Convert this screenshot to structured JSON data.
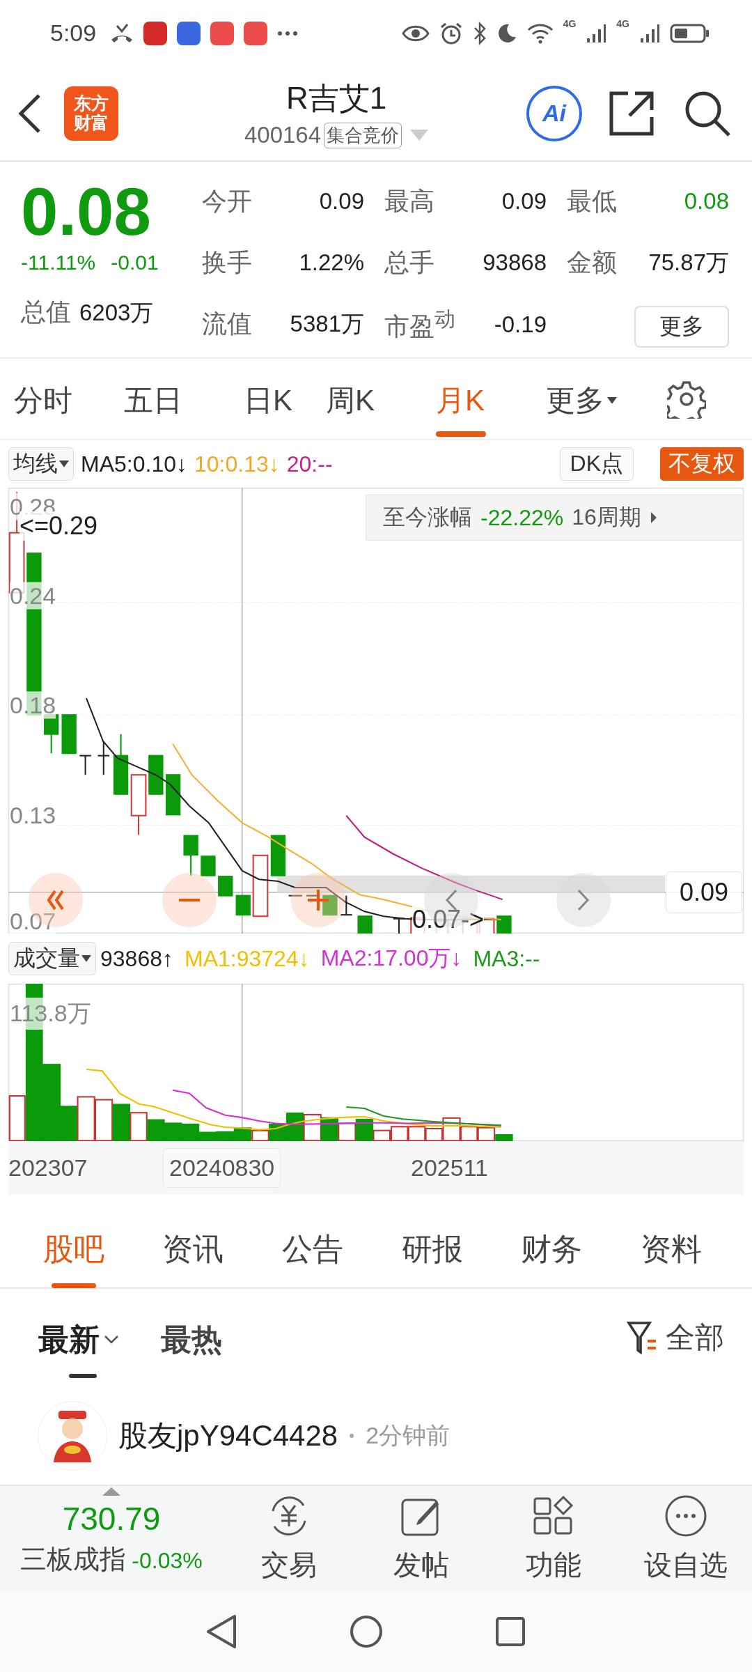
{
  "status_bar": {
    "time": "5:09",
    "signals": [
      {
        "label": "4G"
      },
      {
        "label": "4G"
      }
    ]
  },
  "header": {
    "logo_lines": [
      "东方",
      "财富"
    ],
    "title": "R吉艾1",
    "code": "400164",
    "badge": "集合竞价",
    "ai_label": "Ai"
  },
  "quote": {
    "price": "0.08",
    "change_pct": "-11.11%",
    "change": "-0.01",
    "total_value": {
      "label": "总值",
      "value": "6203万"
    },
    "stats": [
      {
        "label": "今开",
        "value": "0.09",
        "down": false
      },
      {
        "label": "最高",
        "value": "0.09",
        "down": false
      },
      {
        "label": "最低",
        "value": "0.08",
        "down": true
      },
      {
        "label": "换手",
        "value": "1.22%",
        "down": false
      },
      {
        "label": "总手",
        "value": "93868",
        "down": false
      },
      {
        "label": "金额",
        "value": "75.87万",
        "down": false
      },
      {
        "label": "流值",
        "value": "5381万",
        "down": false
      },
      {
        "label": "市盈$^{动}$",
        "value": "-0.19",
        "down": false
      }
    ],
    "more_button": "更多"
  },
  "period_tabs": [
    {
      "label": "分时",
      "selected": false
    },
    {
      "label": "五日",
      "selected": false
    },
    {
      "label": "日K",
      "selected": false
    },
    {
      "label": "周K",
      "selected": false
    },
    {
      "label": "月K",
      "selected": true
    },
    {
      "label": "更多",
      "selected": false,
      "dropdown": true
    }
  ],
  "kline": {
    "indicator": "均线",
    "mas": [
      {
        "text": "MA5:0.10↓",
        "color": "#222222"
      },
      {
        "text": "10:0.13↓",
        "color": "#f5a623"
      },
      {
        "text": "20:--",
        "color": "#cc1f8f"
      }
    ],
    "dk_button": "DK点",
    "adjust_button": "不复权",
    "range": {
      "label": "至今涨幅",
      "value": "-22.22%",
      "periods": "16周期"
    },
    "y_labels": [
      "0.28",
      "0.24",
      "0.18",
      "0.13",
      "0.07"
    ],
    "high_marker": "<=0.29",
    "low_marker": "0.07->",
    "price_tag": "0.09"
  },
  "volume": {
    "indicator": "成交量",
    "value": "93868↑",
    "mas": [
      {
        "text": "MA1:93724↓",
        "color": "#f0c000"
      },
      {
        "text": "MA2:17.00万↓",
        "color": "#d62fd6"
      },
      {
        "text": "MA3:--",
        "color": "#1a9a1a"
      }
    ],
    "max_label": "113.8万",
    "dates": [
      {
        "label": "202307",
        "selected": false
      },
      {
        "label": "20240830",
        "selected": true
      },
      {
        "label": "202511",
        "selected": false
      }
    ]
  },
  "content_tabs": [
    {
      "label": "股吧",
      "selected": true
    },
    {
      "label": "资讯",
      "selected": false
    },
    {
      "label": "公告",
      "selected": false
    },
    {
      "label": "研报",
      "selected": false
    },
    {
      "label": "财务",
      "selected": false
    },
    {
      "label": "资料",
      "selected": false
    }
  ],
  "sort_tabs": [
    {
      "label": "最新",
      "selected": true,
      "dropdown": true
    },
    {
      "label": "最热",
      "selected": false,
      "dropdown": false
    }
  ],
  "filter": "全部",
  "post": {
    "user": "股友jpY94C4428",
    "time": "2分钟前"
  },
  "bottom_bar": {
    "index_value": "730.79",
    "index_name": "三板成指",
    "index_change": "-0.03%",
    "actions": [
      {
        "kind": "trade",
        "label": "交易"
      },
      {
        "kind": "post",
        "label": "发帖"
      },
      {
        "kind": "apps",
        "label": "功能"
      },
      {
        "kind": "more",
        "label": "设自选"
      }
    ]
  }
}
